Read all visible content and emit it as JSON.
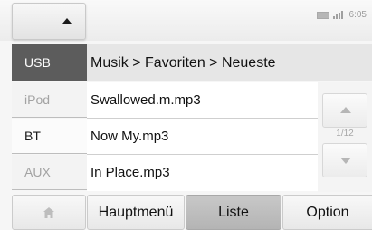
{
  "status": {
    "time": "6:05",
    "battery_icon": "battery-icon",
    "signal_icon": "signal-icon"
  },
  "sources": {
    "usb": "USB",
    "ipod": "iPod",
    "bt": "BT",
    "aux": "AUX",
    "selected": "USB"
  },
  "path": "Musik > Favoriten > Neueste",
  "tracks": [
    {
      "title": "Swallowed.m.mp3"
    },
    {
      "title": "Now My.mp3"
    },
    {
      "title": "In Place.mp3"
    }
  ],
  "scroll": {
    "page": "1/12"
  },
  "bottom": {
    "home_icon": "home-icon",
    "menu": "Hauptmenü",
    "list": "Liste",
    "option": "Option",
    "active": "Liste"
  },
  "colors": {
    "selected_source_bg": "#5c5c5c",
    "active_tab_bg": "#bdbdbd",
    "path_bg": "#e6e6e6"
  }
}
